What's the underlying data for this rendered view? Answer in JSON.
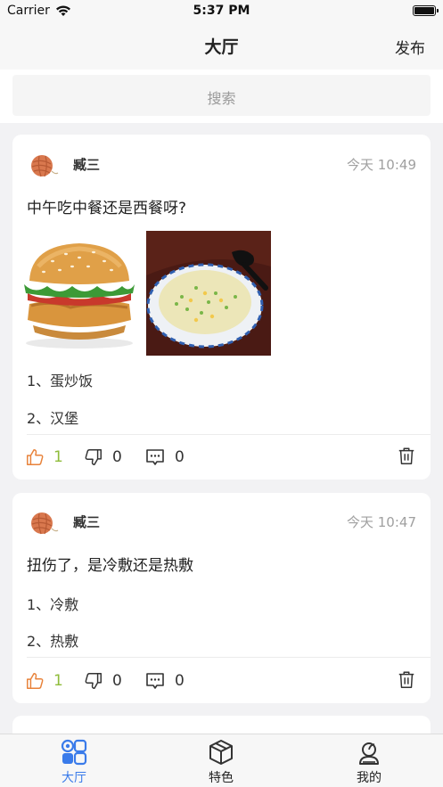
{
  "status_bar": {
    "carrier": "Carrier",
    "time": "5:37 PM"
  },
  "nav": {
    "title": "大厅",
    "action": "发布"
  },
  "search": {
    "placeholder": "搜索"
  },
  "posts": [
    {
      "username": "臧三",
      "time": "今天 10:49",
      "question": "中午吃中餐还是西餐呀?",
      "images": [
        "hamburger",
        "fried-rice"
      ],
      "options": [
        "1、蛋炒饭",
        "2、汉堡"
      ],
      "likes": "1",
      "dislikes": "0",
      "comments": "0"
    },
    {
      "username": "臧三",
      "time": "今天 10:47",
      "question": "扭伤了，是冷敷还是热敷",
      "options": [
        "1、冷敷",
        "2、热敷"
      ],
      "likes": "1",
      "dislikes": "0",
      "comments": "0"
    }
  ],
  "tabs": [
    {
      "label": "大厅",
      "icon": "hall-icon",
      "active": true
    },
    {
      "label": "特色",
      "icon": "cube-icon",
      "active": false
    },
    {
      "label": "我的",
      "icon": "profile-icon",
      "active": false
    }
  ],
  "colors": {
    "accent": "#3a7bea",
    "like": "#e8823a",
    "like_count": "#8fbc3b"
  }
}
